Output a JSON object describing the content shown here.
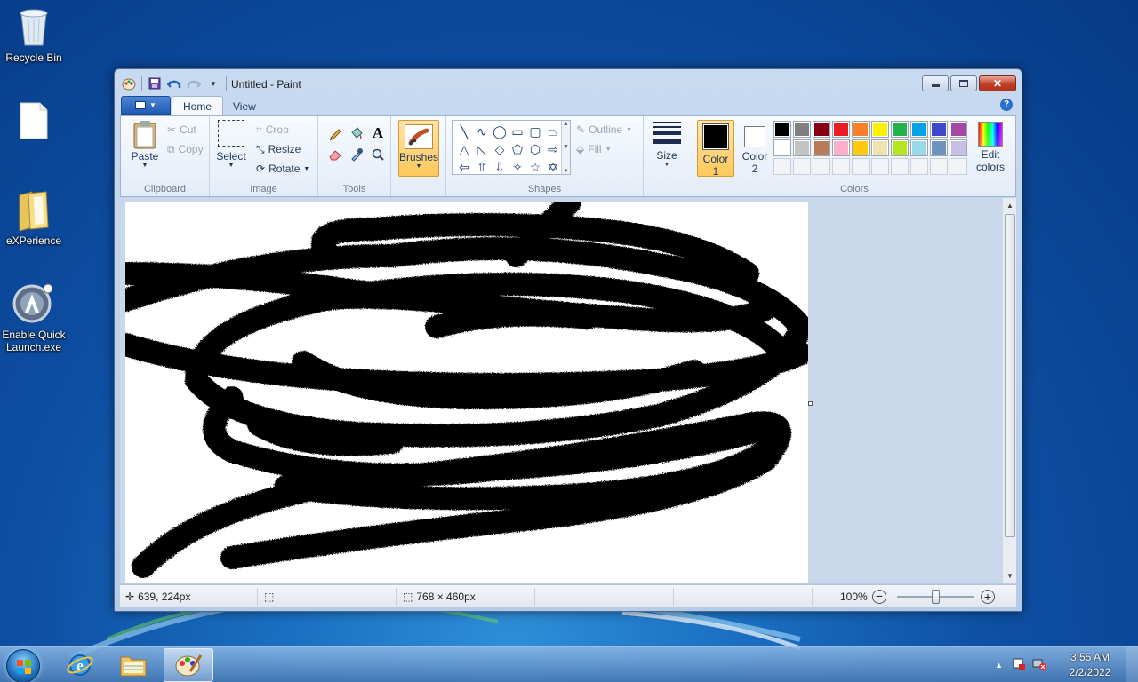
{
  "desktop": {
    "icons": [
      {
        "label": "Recycle Bin",
        "icon": "recycle-bin-icon"
      },
      {
        "label": "",
        "icon": "blank-file-icon"
      },
      {
        "label": "eXPerience",
        "icon": "folder-icon"
      },
      {
        "label": "Enable Quick Launch.exe",
        "icon": "quick-launch-icon"
      }
    ]
  },
  "window": {
    "title": "Untitled - Paint",
    "tabs": [
      {
        "label": "Home",
        "active": true
      },
      {
        "label": "View",
        "active": false
      }
    ]
  },
  "ribbon": {
    "clipboard": {
      "label": "Clipboard",
      "paste": "Paste",
      "cut": "Cut",
      "copy": "Copy"
    },
    "image": {
      "label": "Image",
      "select": "Select",
      "crop": "Crop",
      "resize": "Resize",
      "rotate": "Rotate"
    },
    "tools": {
      "label": "Tools"
    },
    "brushes": {
      "label": "Brushes"
    },
    "shapes": {
      "label": "Shapes",
      "outline": "Outline",
      "fill": "Fill"
    },
    "size": {
      "label": "Size"
    },
    "colors": {
      "label": "Colors",
      "color1": "Color",
      "color1_num": "1",
      "color2": "Color",
      "color2_num": "2",
      "color1_value": "#000000",
      "color2_value": "#ffffff",
      "edit": "Edit",
      "edit2": "colors",
      "palette": [
        "#000000",
        "#7f7f7f",
        "#880015",
        "#ed1c24",
        "#ff7f27",
        "#fff200",
        "#22b14c",
        "#00a2e8",
        "#3f48cc",
        "#a349a4",
        "#ffffff",
        "#c3c3c3",
        "#b97a57",
        "#ffaec9",
        "#ffc90e",
        "#efe4b0",
        "#b5e61d",
        "#99d9ea",
        "#7092be",
        "#c8bfe7",
        "",
        "",
        "",
        "",
        "",
        "",
        "",
        "",
        "",
        ""
      ]
    }
  },
  "statusbar": {
    "cursor_pos": "639, 224px",
    "selection_size": "",
    "canvas_size": "768 × 460px",
    "zoom": "100%",
    "zoom_fraction": 0.5
  },
  "taskbar": {
    "time": "3:55 AM",
    "date": "2/2/2022"
  }
}
